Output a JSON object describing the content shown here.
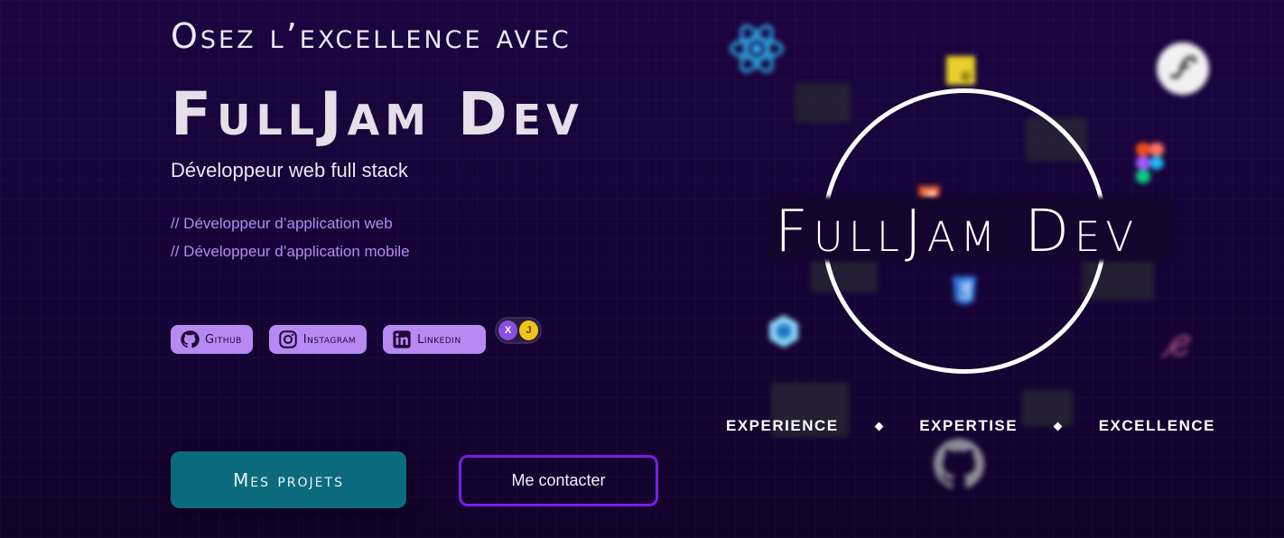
{
  "hero": {
    "kicker": "Osez l’excellence avec",
    "brand": "FullJam Dev",
    "subtitle": "Développeur web full stack",
    "roles": [
      "// Développeur d’application web",
      "// Développeur d’application mobile"
    ]
  },
  "social": {
    "github": "Github",
    "instagram": "Instagram",
    "linkedin": "Linkedin"
  },
  "theme_toggle": {
    "left": "X",
    "right": "J"
  },
  "actions": {
    "primary": "Mes projets",
    "secondary": "Me contacter"
  },
  "logo": {
    "text": "FullJam Dev",
    "values": [
      "EXPERIENCE",
      "EXPERTISE",
      "EXCELLENCE"
    ]
  },
  "colors": {
    "background": "#1a033c",
    "accent_purple": "#b78af2",
    "primary_button": "#0b6b7c",
    "outline_button": "#7a1de8"
  },
  "floating_icons": [
    "react-icon",
    "javascript-icon",
    "symfony-icon",
    "figma-icon",
    "html5-icon",
    "css3-icon",
    "webpack-icon",
    "sass-icon",
    "github-icon"
  ]
}
